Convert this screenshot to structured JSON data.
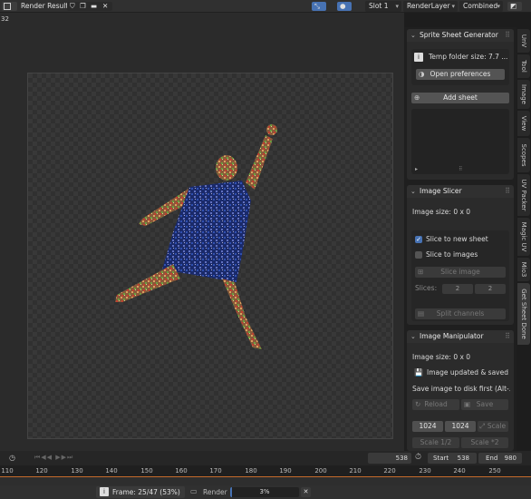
{
  "header": {
    "title": "Render Result",
    "slot": "Slot 1",
    "layer": "RenderLayer",
    "pass": "Combined"
  },
  "viewport": {
    "frame_label": "32"
  },
  "vtabs": [
    "UnV",
    "Tool",
    "Image",
    "View",
    "Scopes",
    "UV Packer",
    "Magic UV",
    "Mio3",
    "Get Sheet Done"
  ],
  "sprite_sheet_generator": {
    "title": "Sprite Sheet Generator",
    "temp_folder": "Temp folder size: 7.7 ...",
    "open_prefs": "Open preferences",
    "add_sheet": "Add sheet"
  },
  "image_slicer": {
    "title": "Image Slicer",
    "image_size": "Image size: 0 x 0",
    "slice_new_sheet": "Slice to new sheet",
    "slice_images": "Slice to images",
    "slice_image_btn": "Slice image",
    "slices_label": "Slices:",
    "slices_x": "2",
    "slices_y": "2",
    "split_channels": "Split channels"
  },
  "image_manipulator": {
    "title": "Image Manipulator",
    "image_size": "Image size: 0 x 0",
    "updated": "Image updated & saved",
    "save_first": "Save image to disk first (Alt-...",
    "reload": "Reload",
    "save": "Save",
    "w": "1024",
    "h": "1024",
    "scale": "Scale",
    "scale_half": "Scale 1/2",
    "scale_double": "Scale *2"
  },
  "timeline": {
    "current_frame": "538",
    "start_label": "Start",
    "start": "538",
    "end_label": "End",
    "end": "980",
    "ticks": [
      "110",
      "120",
      "130",
      "140",
      "150",
      "160",
      "170",
      "180",
      "190",
      "200",
      "210",
      "220",
      "230",
      "240",
      "250"
    ]
  },
  "status": {
    "frame": "Frame: 25/47 (53%)",
    "render_label": "Render",
    "render_progress": "3%"
  }
}
